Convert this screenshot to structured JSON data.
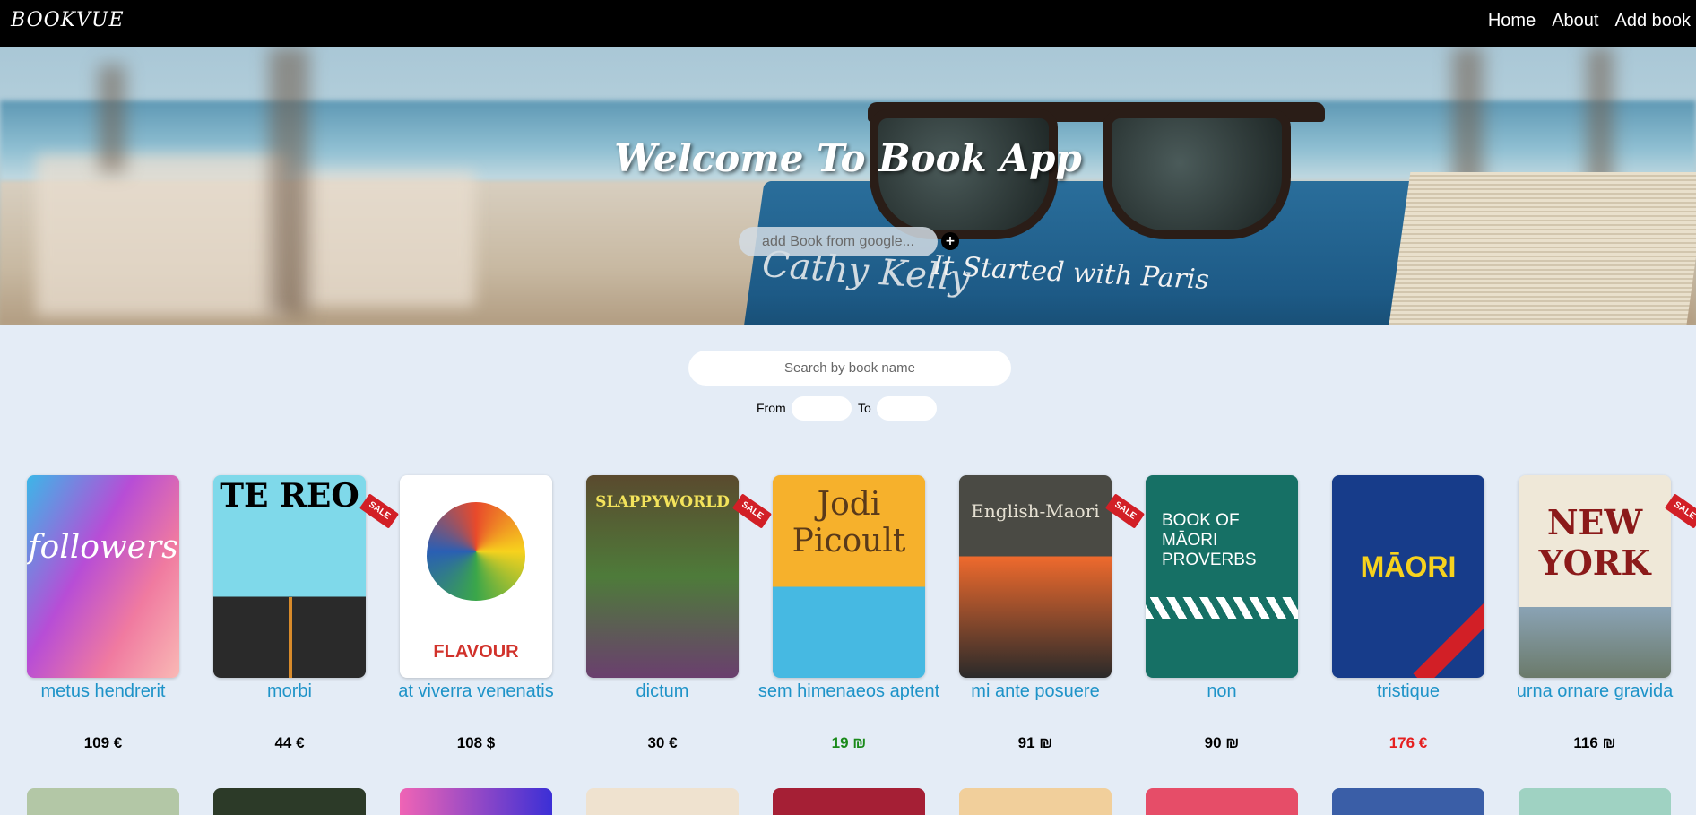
{
  "navbar": {
    "brand": "BOOKVUE",
    "links": [
      "Home",
      "About",
      "Add book"
    ]
  },
  "hero": {
    "title": "Welcome To Book App",
    "google_placeholder": "add Book from google...",
    "add_symbol": "+",
    "book_author_text": "Cathy Kelly",
    "book_title_text": "It Started with Paris"
  },
  "search": {
    "placeholder": "Search by book name",
    "from_label": "From",
    "to_label": "To"
  },
  "books": [
    {
      "title": "metus hendrerit",
      "price": "109 €",
      "price_color": "#000000",
      "cover_color": "#f2a4b0",
      "cover_text": "followers",
      "sale": false
    },
    {
      "title": "morbi",
      "price": "44 €",
      "price_color": "#000000",
      "cover_color": "#7fd9ea",
      "cover_text": "TE REO",
      "sale": true
    },
    {
      "title": "at viverra venenatis",
      "price": "108 $",
      "price_color": "#000000",
      "cover_color": "#ffffff",
      "cover_text": "FLAVOUR",
      "sale": false
    },
    {
      "title": "dictum",
      "price": "30 €",
      "price_color": "#000000",
      "cover_color": "#5a4a2e",
      "cover_text": "SLAPPYWORLD",
      "sale": true
    },
    {
      "title": "sem himenaeos aptent",
      "price": "19 ₪",
      "price_color": "#1a8a1a",
      "cover_color": "#f6b12c",
      "cover_text": "Jodi Picoult",
      "sale": false
    },
    {
      "title": "mi ante posuere",
      "price": "91 ₪",
      "price_color": "#000000",
      "cover_color": "#4a4a44",
      "cover_text": "English-Maori",
      "sale": true
    },
    {
      "title": "non",
      "price": "90 ₪",
      "price_color": "#000000",
      "cover_color": "#167065",
      "cover_text": "BOOK OF MĀORI PROVERBS",
      "sale": false
    },
    {
      "title": "tristique",
      "price": "176 €",
      "price_color": "#e52020",
      "cover_color": "#173c8a",
      "cover_text": "MĀORI",
      "sale": false
    },
    {
      "title": "urna ornare gravida",
      "price": "116 ₪",
      "price_color": "#000000",
      "cover_color": "#efe8d8",
      "cover_text": "NEW YORK",
      "sale": true
    }
  ]
}
